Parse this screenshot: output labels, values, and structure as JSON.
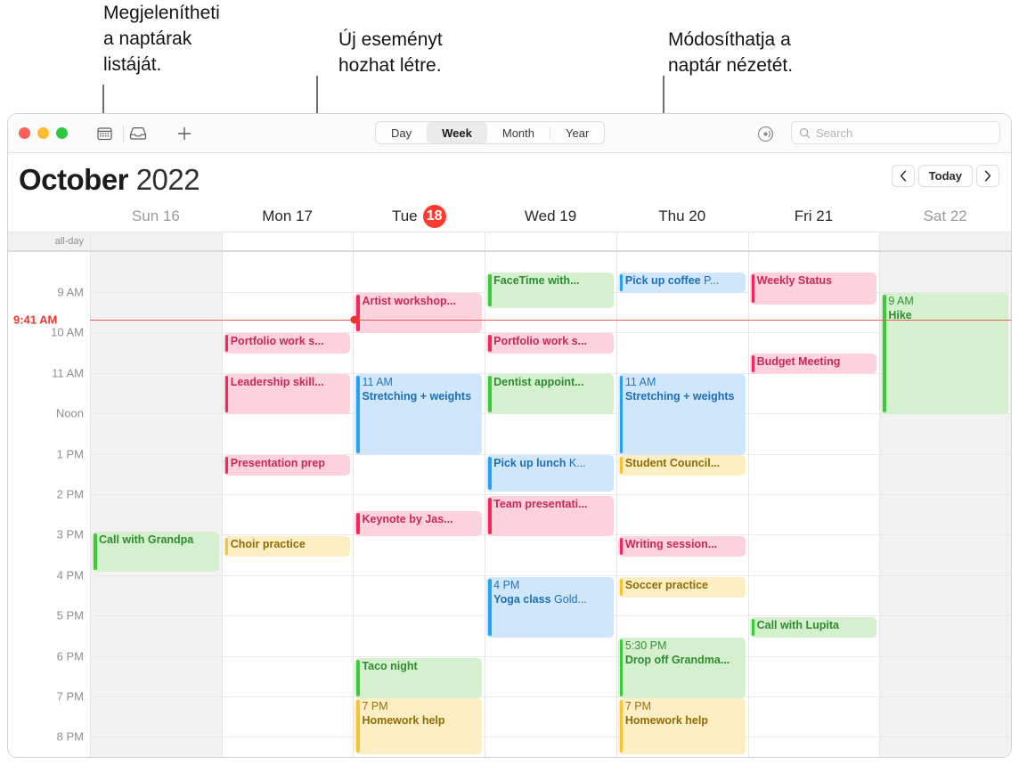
{
  "callouts": [
    {
      "id": "sidebar",
      "text": "Megjelenítheti\na naptárak\nlistáját."
    },
    {
      "id": "newevent",
      "text": "Új eseményt\nhozhat létre."
    },
    {
      "id": "view",
      "text": "Módosíthatja a\nnaptár nézetét."
    }
  ],
  "toolbar": {
    "icons": {
      "calendar": "calendar-icon",
      "inbox": "inbox-icon",
      "add": "plus-icon",
      "airplay": "airplay-icon"
    },
    "segments": [
      {
        "label": "Day",
        "selected": false
      },
      {
        "label": "Week",
        "selected": true
      },
      {
        "label": "Month",
        "selected": false
      },
      {
        "label": "Year",
        "selected": false
      }
    ],
    "search_placeholder": "Search",
    "search_value": ""
  },
  "header": {
    "month": "October",
    "year": "2022",
    "prev_label": "‹",
    "today_label": "Today",
    "next_label": "›"
  },
  "grid": {
    "allday_label": "all-day",
    "days": [
      {
        "label": "Sun 16",
        "name": "Sun",
        "num": "16",
        "dim": true,
        "today": false,
        "weekend": true
      },
      {
        "label": "Mon 17",
        "name": "Mon",
        "num": "17",
        "dim": false,
        "today": false,
        "weekend": false
      },
      {
        "label": "Tue 18",
        "name": "Tue",
        "num": "18",
        "dim": false,
        "today": true,
        "weekend": false
      },
      {
        "label": "Wed 19",
        "name": "Wed",
        "num": "19",
        "dim": false,
        "today": false,
        "weekend": false
      },
      {
        "label": "Thu 20",
        "name": "Thu",
        "num": "20",
        "dim": false,
        "today": false,
        "weekend": false
      },
      {
        "label": "Fri 21",
        "name": "Fri",
        "num": "21",
        "dim": false,
        "today": false,
        "weekend": false
      },
      {
        "label": "Sat 22",
        "name": "Sat",
        "num": "22",
        "dim": true,
        "today": false,
        "weekend": true
      }
    ],
    "hours": [
      "9 AM",
      "10 AM",
      "11 AM",
      "Noon",
      "1 PM",
      "2 PM",
      "3 PM",
      "4 PM",
      "5 PM",
      "6 PM",
      "7 PM",
      "8 PM"
    ],
    "now": {
      "label": "9:41 AM",
      "color": "#f0352b"
    }
  },
  "events": [
    {
      "day": 0,
      "start": 605,
      "end": 650,
      "color": "green",
      "name": "Call with Grandpa",
      "time": "",
      "loc": ""
    },
    {
      "day": 1,
      "start": 382,
      "end": 405,
      "color": "red",
      "name": "Portfolio work s...",
      "time": "",
      "loc": ""
    },
    {
      "day": 1,
      "start": 428,
      "end": 473,
      "color": "red",
      "name": "Leadership skill...",
      "time": "",
      "loc": ""
    },
    {
      "day": 1,
      "start": 519,
      "end": 542,
      "color": "red",
      "name": "Presentation prep",
      "time": "",
      "loc": ""
    },
    {
      "day": 1,
      "start": 610,
      "end": 633,
      "color": "yellow",
      "name": "Choir practice",
      "time": "",
      "loc": ""
    },
    {
      "day": 2,
      "start": 337,
      "end": 382,
      "color": "red",
      "name": "Artist workshop...",
      "time": "",
      "loc": ""
    },
    {
      "day": 2,
      "start": 428,
      "end": 519,
      "color": "blue",
      "name": "Stretching + weights",
      "time": "11 AM",
      "loc": ""
    },
    {
      "day": 2,
      "start": 582,
      "end": 610,
      "color": "red",
      "name": "Keynote by Jas...",
      "time": "",
      "loc": ""
    },
    {
      "day": 2,
      "start": 747,
      "end": 792,
      "color": "green",
      "name": "Taco night",
      "time": "",
      "loc": ""
    },
    {
      "day": 2,
      "start": 792,
      "end": 855,
      "color": "yellow",
      "name": "Homework help",
      "time": "7 PM",
      "loc": ""
    },
    {
      "day": 3,
      "start": 314,
      "end": 354,
      "color": "green",
      "name": "FaceTime with...",
      "time": "",
      "loc": ""
    },
    {
      "day": 3,
      "start": 382,
      "end": 405,
      "color": "red",
      "name": "Portfolio work s...",
      "time": "",
      "loc": ""
    },
    {
      "day": 3,
      "start": 428,
      "end": 473,
      "color": "green",
      "name": "Dentist appoint...",
      "time": "",
      "loc": ""
    },
    {
      "day": 3,
      "start": 519,
      "end": 560,
      "color": "blue",
      "name": "Pick up lunch",
      "time": "",
      "loc": "K..."
    },
    {
      "day": 3,
      "start": 565,
      "end": 610,
      "color": "red",
      "name": "Team presentati...",
      "time": "",
      "loc": ""
    },
    {
      "day": 3,
      "start": 656,
      "end": 724,
      "color": "blue",
      "name": "Yoga class",
      "time": "4 PM",
      "loc": "Gold..."
    },
    {
      "day": 4,
      "start": 314,
      "end": 337,
      "color": "blue",
      "name": "Pick up coffee",
      "time": "",
      "loc": "P..."
    },
    {
      "day": 4,
      "start": 428,
      "end": 519,
      "color": "blue",
      "name": "Stretching + weights",
      "time": "11 AM",
      "loc": ""
    },
    {
      "day": 4,
      "start": 519,
      "end": 542,
      "color": "yellow",
      "name": "Student Council...",
      "time": "",
      "loc": ""
    },
    {
      "day": 4,
      "start": 610,
      "end": 633,
      "color": "red",
      "name": "Writing session...",
      "time": "",
      "loc": ""
    },
    {
      "day": 4,
      "start": 656,
      "end": 679,
      "color": "yellow",
      "name": "Soccer practice",
      "time": "",
      "loc": ""
    },
    {
      "day": 4,
      "start": 724,
      "end": 792,
      "color": "green",
      "name": "Drop off Grandma...",
      "time": "5:30 PM",
      "loc": ""
    },
    {
      "day": 4,
      "start": 792,
      "end": 855,
      "color": "yellow",
      "name": "Homework help",
      "time": "7 PM",
      "loc": ""
    },
    {
      "day": 5,
      "start": 314,
      "end": 350,
      "color": "red",
      "name": "Weekly Status",
      "time": "",
      "loc": ""
    },
    {
      "day": 5,
      "start": 405,
      "end": 428,
      "color": "red",
      "name": "Budget Meeting",
      "time": "",
      "loc": ""
    },
    {
      "day": 5,
      "start": 701,
      "end": 724,
      "color": "green",
      "name": "Call with Lupita",
      "time": "",
      "loc": ""
    },
    {
      "day": 6,
      "start": 337,
      "end": 473,
      "color": "green",
      "name": "Hike",
      "time": "9 AM",
      "loc": ""
    }
  ]
}
